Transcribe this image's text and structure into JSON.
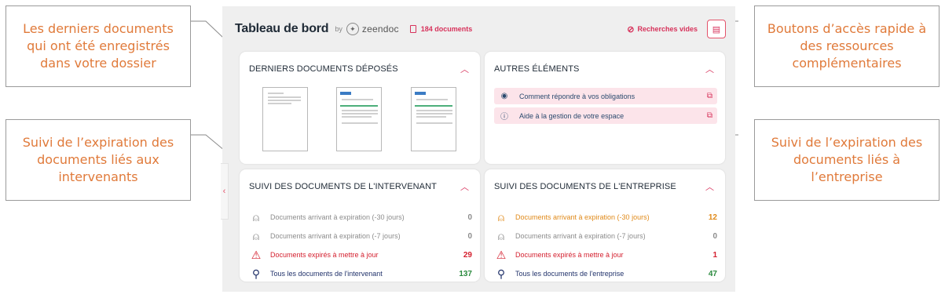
{
  "callouts": {
    "latest": "Les derniers documents qui ont été enregistrés dans votre dossier",
    "contractor": "Suivi de l’expiration des documents liés aux intervenants",
    "quick": "Boutons d’accès rapide à des ressources complémentaires",
    "company": "Suivi de l’expiration des documents liés à l’entreprise"
  },
  "header": {
    "title": "Tableau de bord",
    "by": "by",
    "brand": "zeendoc",
    "doc_count": "184 documents",
    "empty_searches": "Recherches vides"
  },
  "latest_docs": {
    "title": "DERNIERS DOCUMENTS DÉPOSÉS"
  },
  "other": {
    "title": "AUTRES ÉLÉMENTS",
    "links": [
      "Comment répondre à vos obligations",
      "Aide à la gestion de votre espace"
    ]
  },
  "contractor_docs": {
    "title": "SUIVI DES DOCUMENTS DE L'INTERVENANT",
    "rows": [
      {
        "label": "Documents arrivant à expiration (-30 jours)",
        "count": "0"
      },
      {
        "label": "Documents arrivant à expiration (-7 jours)",
        "count": "0"
      },
      {
        "label": "Documents expirés à mettre à jour",
        "count": "29"
      },
      {
        "label": "Tous les documents de l'intervenant",
        "count": "137"
      }
    ]
  },
  "company_docs": {
    "title": "SUIVI DES DOCUMENTS DE L'ENTREPRISE",
    "rows": [
      {
        "label": "Documents arrivant à expiration (-30 jours)",
        "count": "12"
      },
      {
        "label": "Documents arrivant à expiration (-7 jours)",
        "count": "0"
      },
      {
        "label": "Documents expirés à mettre à jour",
        "count": "1"
      },
      {
        "label": "Tous les documents de l'entreprise",
        "count": "47"
      }
    ]
  },
  "colors": {
    "accent": "#d7325b",
    "callout": "#e07a3a",
    "warning": "#e08a1a",
    "danger": "#d41f2e",
    "success": "#2a8a3e"
  },
  "icons": {
    "expiring": "siren-icon",
    "expired": "warning-triangle-icon",
    "all": "search-icon",
    "eye": "eye-icon",
    "help": "question-circle-icon",
    "external": "external-link-icon"
  }
}
